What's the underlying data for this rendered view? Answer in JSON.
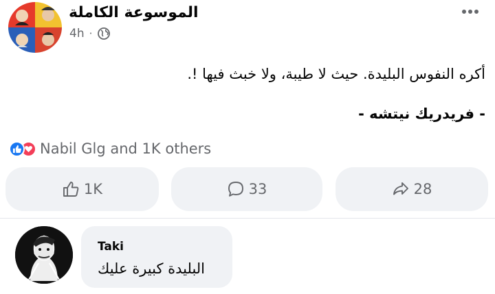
{
  "post": {
    "page_name": "الموسوعة الكاملة",
    "time": "4h",
    "separator": "·",
    "privacy_icon": "globe-icon",
    "menu_icon": "more-dots-icon",
    "text_line1": "أكره النفوس البليدة. حيث لا طيبة، ولا خبث فيها !.",
    "text_line2": "- فريدريك نيتشه -"
  },
  "reactions": {
    "icons": [
      "like-icon",
      "love-icon"
    ],
    "summary": "Nabil Glg and 1K others"
  },
  "actions": {
    "like_count": "1K",
    "comment_count": "33",
    "share_count": "28"
  },
  "comment": {
    "author": "Taki",
    "text": "البليدة كبيرة عليك"
  },
  "colors": {
    "like_blue": "#1877f2",
    "love_red": "#f33e58",
    "button_bg": "#f0f2f5",
    "secondary_text": "#65676b"
  }
}
